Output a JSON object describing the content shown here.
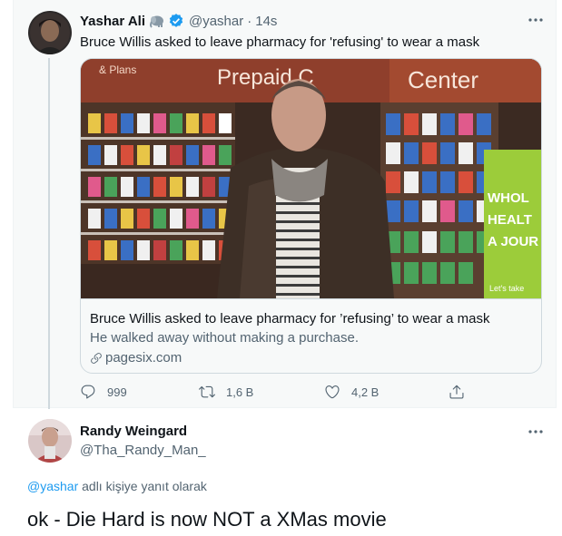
{
  "tweet": {
    "author_name": "Yashar Ali",
    "author_handle": "@yashar",
    "separator": "·",
    "time_ago": "14s",
    "badge_emoji": "elephant-icon",
    "verified_icon": "verified-badge-icon",
    "text": "Bruce Willis asked to leave pharmacy for 'refusing' to wear a mask",
    "card": {
      "image_signage": {
        "prepaid": "Prepaid C",
        "plans": "& Plans",
        "center": "Center",
        "side_sign": [
          "WHOL",
          "HEALT",
          "A JOUR",
          "Let's take"
        ]
      },
      "title": "Bruce Willis asked to leave pharmacy for ’refusing’ to wear a mask",
      "description": "He walked away without making a purchase.",
      "domain": "pagesix.com"
    },
    "actions": {
      "replies": "999",
      "retweets": "1,6 B",
      "likes": "4,2 B"
    }
  },
  "reply": {
    "author_name": "Randy Weingard",
    "author_handle": "@Tha_Randy_Man_",
    "replying_to_mention": "@yashar",
    "replying_to_suffix": "adlı kişiye yanıt olarak",
    "text": "ok - Die Hard is now NOT a XMas movie"
  },
  "colors": {
    "accent": "#1d9bf0",
    "secondary_text": "#536471",
    "panel_bg": "#f7f9f9"
  }
}
